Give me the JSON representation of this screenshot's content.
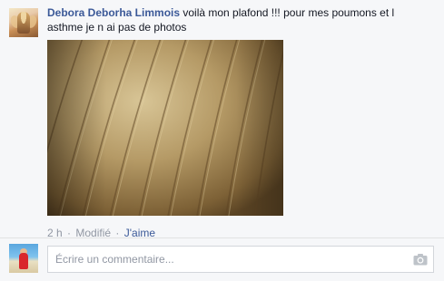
{
  "comment": {
    "author": "Debora Deborha Limmois",
    "text": " voilà mon plafond !!! pour mes poumons et l asthme je n ai pas de photos",
    "meta": {
      "time": "2 h",
      "separator": "·",
      "edited": "Modifié",
      "like": "J'aime"
    }
  },
  "reply": {
    "placeholder": "Écrire un commentaire..."
  },
  "colors": {
    "link": "#3b5998",
    "meta": "#9197a3",
    "background": "#f6f7f9"
  },
  "icons": {
    "camera": "camera-icon"
  }
}
